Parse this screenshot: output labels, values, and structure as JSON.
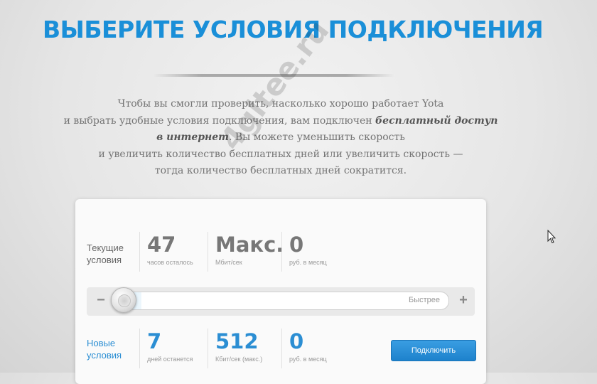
{
  "header": {
    "title": "ВЫБЕРИТЕ УСЛОВИЯ ПОДКЛЮЧЕНИЯ"
  },
  "intro": {
    "line1": "Чтобы вы смогли проверить, насколько хорошо работает Yota",
    "line2_start": "и выбрать удобные условия подключения, вам подключен ",
    "line2_em": "бесплатный доступ",
    "line3_em": "в интернет",
    "line3_rest": ". Вы можете уменьшить скорость",
    "line4": "и увеличить количество бесплатных дней или увеличить скорость —",
    "line5": "тогда количество бесплатных дней сократится."
  },
  "watermark": "4gltee.ru",
  "current": {
    "label_line1": "Текущие",
    "label_line2": "условия",
    "hours_value": "47",
    "hours_unit": "часов осталось",
    "speed_value": "Макс.",
    "speed_unit": "Мбит/сек",
    "price_value": "0",
    "price_unit": "руб. в месяц"
  },
  "slider": {
    "minus_label": "−",
    "plus_label": "+",
    "hint": "Быстрее",
    "level_fraction": 0.0
  },
  "new_terms": {
    "label_line1": "Новые",
    "label_line2": "условия",
    "days_value": "7",
    "days_unit": "дней останется",
    "speed_value": "512",
    "speed_unit": "Кбит/сек (макс.)",
    "price_value": "0",
    "price_unit": "руб. в месяц",
    "connect_button": "Подключить"
  },
  "colors": {
    "accent": "#1a8fd8",
    "button": "#2b8ed3"
  }
}
